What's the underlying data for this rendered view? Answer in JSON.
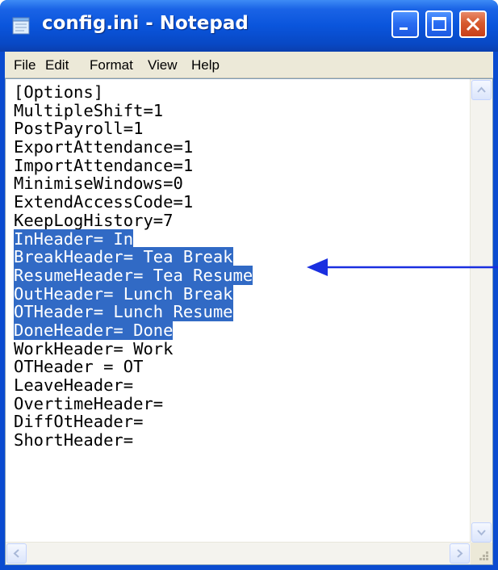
{
  "window": {
    "title": "config.ini - Notepad",
    "icon": "notepad-icon",
    "buttons": [
      "minimize-icon",
      "maximize-icon",
      "close-icon"
    ]
  },
  "menu": {
    "file": "File",
    "edit": "Edit",
    "format": "Format",
    "view": "View",
    "help": "Help"
  },
  "content": {
    "lines": [
      "[Options]",
      "MultipleShift=1",
      "PostPayroll=1",
      "ExportAttendance=1",
      "ImportAttendance=1",
      "MinimiseWindows=0",
      "ExtendAccessCode=1",
      "KeepLogHistory=7",
      "InHeader= In",
      "BreakHeader= Tea Break",
      "ResumeHeader= Tea Resume",
      "OutHeader= Lunch Break",
      "OTHeader= Lunch Resume",
      "DoneHeader= Done",
      "WorkHeader= Work",
      "OTHeader = OT",
      "LeaveHeader=",
      "OvertimeHeader=",
      "DiffOtHeader=",
      "ShortHeader="
    ],
    "selected_first_line": 9,
    "selected_last_line": 14
  },
  "colors": {
    "titlebar": "#0a55dc",
    "selection": "#316ac5",
    "menubar": "#ece9d8",
    "annotation_arrow": "#1a2fe0"
  }
}
